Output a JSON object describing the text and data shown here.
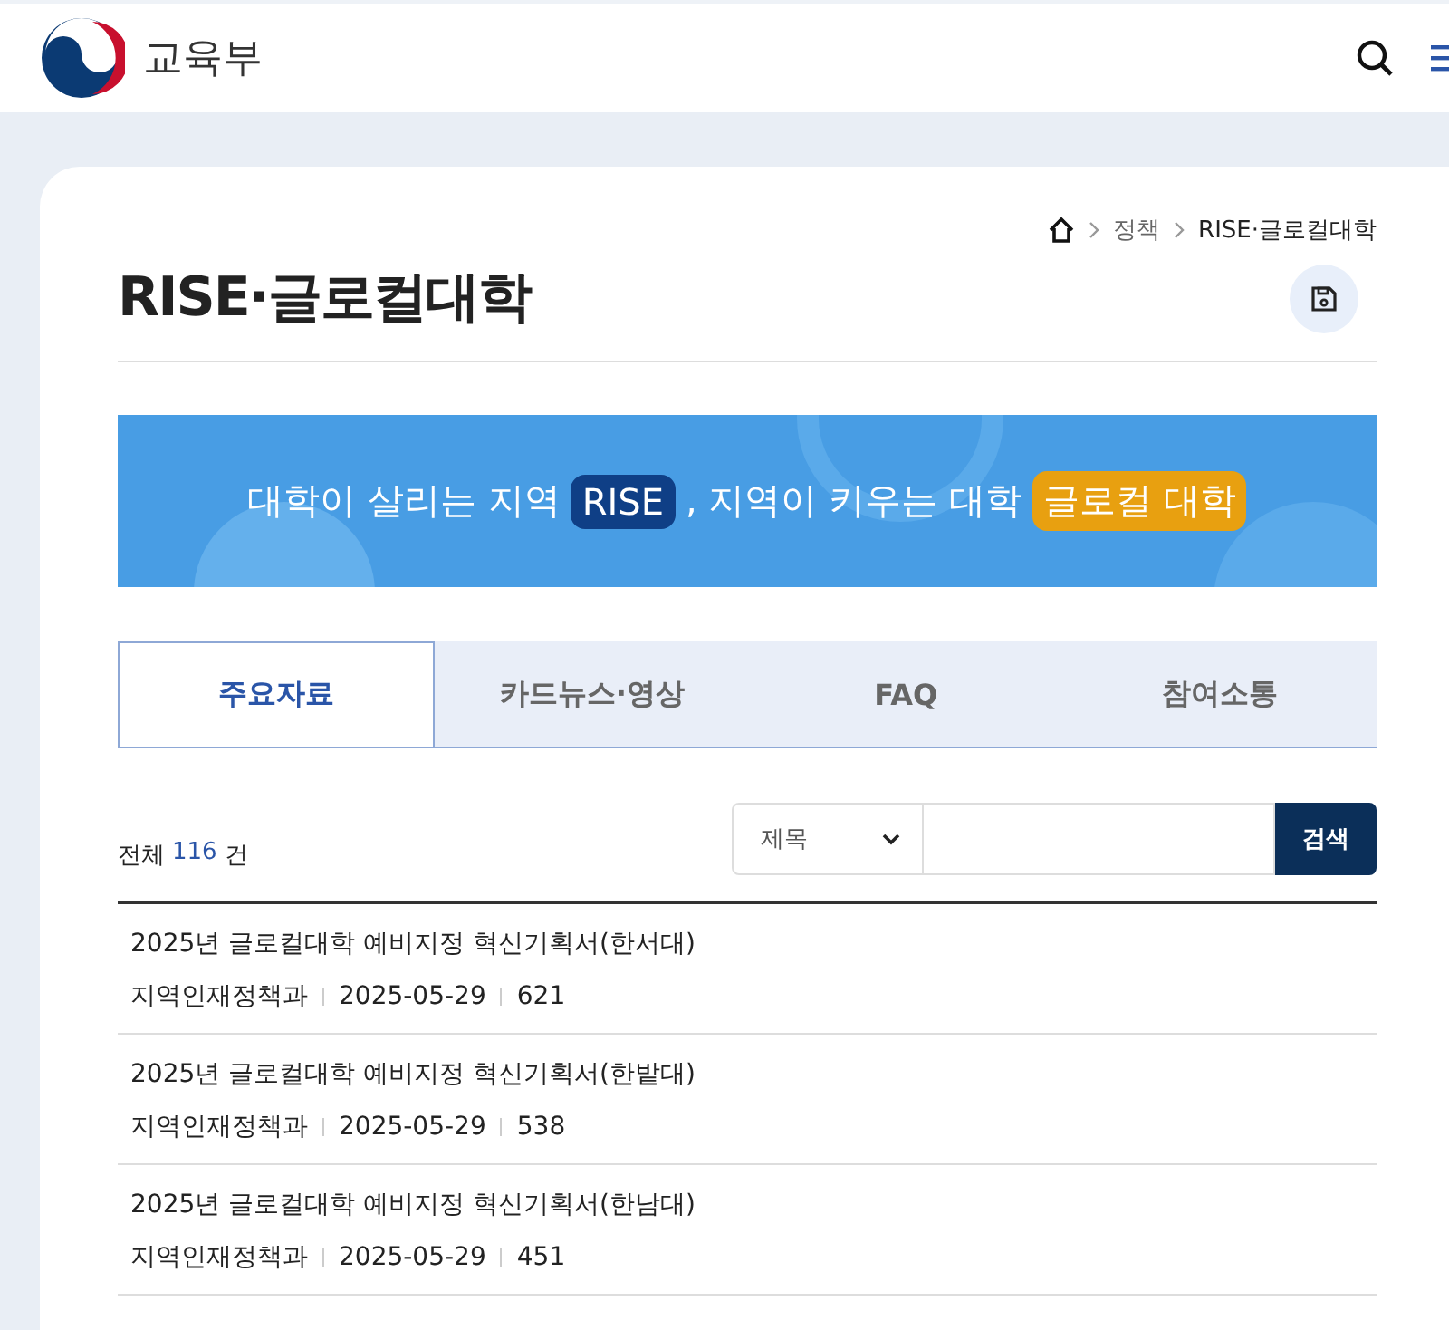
{
  "header": {
    "logo_text": "교육부"
  },
  "breadcrumb": [
    {
      "label": "정책",
      "current": false
    },
    {
      "label": "RISE·글로컬대학",
      "current": true
    }
  ],
  "page_title": "RISE·글로컬대학",
  "banner": {
    "segments": [
      {
        "kind": "text",
        "text": "대학이 살리는 지역"
      },
      {
        "kind": "highlight",
        "text": "RISE",
        "color": "#0f3f86"
      },
      {
        "kind": "text",
        "text": ", 지역이 키우는 대학"
      },
      {
        "kind": "highlight",
        "text": "글로컬 대학",
        "color": "#e8a010"
      }
    ]
  },
  "tabs": [
    {
      "label": "주요자료",
      "selected": true
    },
    {
      "label": "카드뉴스·영상",
      "selected": false
    },
    {
      "label": "FAQ",
      "selected": false
    },
    {
      "label": "참여소통",
      "selected": false
    }
  ],
  "total": {
    "prefix": "전체",
    "count": "116",
    "suffix": "건"
  },
  "search": {
    "select_value": "제목",
    "button": "검색"
  },
  "posts": [
    {
      "title": "2025년 글로컬대학 예비지정 혁신기획서(한서대)",
      "department": "지역인재정책과",
      "date": "2025-05-29",
      "views": "621"
    },
    {
      "title": "2025년 글로컬대학 예비지정 혁신기획서(한밭대)",
      "department": "지역인재정책과",
      "date": "2025-05-29",
      "views": "538"
    },
    {
      "title": "2025년 글로컬대학 예비지정 혁신기획서(한남대)",
      "department": "지역인재정책과",
      "date": "2025-05-29",
      "views": "451"
    }
  ]
}
